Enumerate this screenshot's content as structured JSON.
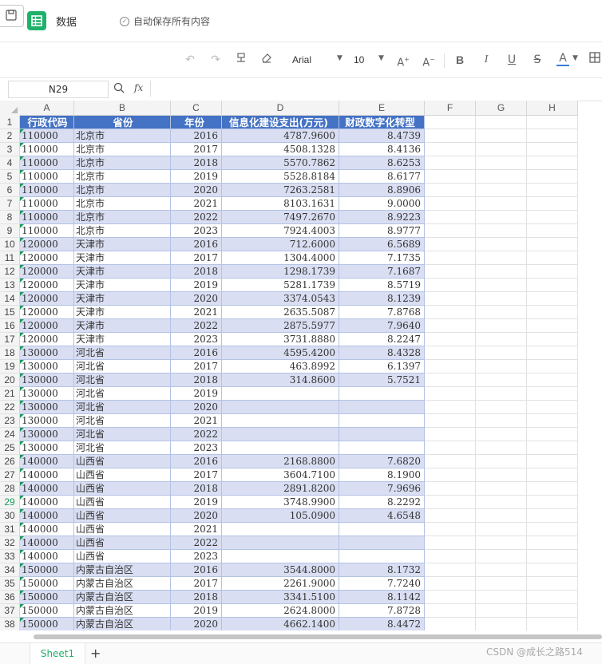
{
  "app": {
    "title": "数据",
    "autosave": "自动保存所有内容"
  },
  "toolbar": {
    "font": "Arial",
    "font_size": "10",
    "text_color": "#3a7bd5"
  },
  "formula_bar": {
    "cell_ref": "N29",
    "fx_label": "fx",
    "formula": ""
  },
  "columns": [
    "A",
    "B",
    "C",
    "D",
    "E",
    "F",
    "G",
    "H"
  ],
  "header_row": [
    "行政代码",
    "省份",
    "年份",
    "信息化建设支出(万元)",
    "财政数字化转型"
  ],
  "rows": [
    [
      "110000",
      "北京市",
      "2016",
      "4787.9600",
      "8.4739"
    ],
    [
      "110000",
      "北京市",
      "2017",
      "4508.1328",
      "8.4136"
    ],
    [
      "110000",
      "北京市",
      "2018",
      "5570.7862",
      "8.6253"
    ],
    [
      "110000",
      "北京市",
      "2019",
      "5528.8184",
      "8.6177"
    ],
    [
      "110000",
      "北京市",
      "2020",
      "7263.2581",
      "8.8906"
    ],
    [
      "110000",
      "北京市",
      "2021",
      "8103.1631",
      "9.0000"
    ],
    [
      "110000",
      "北京市",
      "2022",
      "7497.2670",
      "8.9223"
    ],
    [
      "110000",
      "北京市",
      "2023",
      "7924.4003",
      "8.9777"
    ],
    [
      "120000",
      "天津市",
      "2016",
      "712.6000",
      "6.5689"
    ],
    [
      "120000",
      "天津市",
      "2017",
      "1304.4000",
      "7.1735"
    ],
    [
      "120000",
      "天津市",
      "2018",
      "1298.1739",
      "7.1687"
    ],
    [
      "120000",
      "天津市",
      "2019",
      "5281.1739",
      "8.5719"
    ],
    [
      "120000",
      "天津市",
      "2020",
      "3374.0543",
      "8.1239"
    ],
    [
      "120000",
      "天津市",
      "2021",
      "2635.5087",
      "7.8768"
    ],
    [
      "120000",
      "天津市",
      "2022",
      "2875.5977",
      "7.9640"
    ],
    [
      "120000",
      "天津市",
      "2023",
      "3731.8880",
      "8.2247"
    ],
    [
      "130000",
      "河北省",
      "2016",
      "4595.4200",
      "8.4328"
    ],
    [
      "130000",
      "河北省",
      "2017",
      "463.8992",
      "6.1397"
    ],
    [
      "130000",
      "河北省",
      "2018",
      "314.8600",
      "5.7521"
    ],
    [
      "130000",
      "河北省",
      "2019",
      "",
      ""
    ],
    [
      "130000",
      "河北省",
      "2020",
      "",
      ""
    ],
    [
      "130000",
      "河北省",
      "2021",
      "",
      ""
    ],
    [
      "130000",
      "河北省",
      "2022",
      "",
      ""
    ],
    [
      "130000",
      "河北省",
      "2023",
      "",
      ""
    ],
    [
      "140000",
      "山西省",
      "2016",
      "2168.8800",
      "7.6820"
    ],
    [
      "140000",
      "山西省",
      "2017",
      "3604.7100",
      "8.1900"
    ],
    [
      "140000",
      "山西省",
      "2018",
      "2891.8200",
      "7.9696"
    ],
    [
      "140000",
      "山西省",
      "2019",
      "3748.9900",
      "8.2292"
    ],
    [
      "140000",
      "山西省",
      "2020",
      "105.0900",
      "4.6548"
    ],
    [
      "140000",
      "山西省",
      "2021",
      "",
      ""
    ],
    [
      "140000",
      "山西省",
      "2022",
      "",
      ""
    ],
    [
      "140000",
      "山西省",
      "2023",
      "",
      ""
    ],
    [
      "150000",
      "内蒙古自治区",
      "2016",
      "3544.8000",
      "8.1732"
    ],
    [
      "150000",
      "内蒙古自治区",
      "2017",
      "2261.9000",
      "7.7240"
    ],
    [
      "150000",
      "内蒙古自治区",
      "2018",
      "3341.5100",
      "8.1142"
    ],
    [
      "150000",
      "内蒙古自治区",
      "2019",
      "2624.8000",
      "7.8728"
    ],
    [
      "150000",
      "内蒙古自治区",
      "2020",
      "4662.1400",
      "8.4472"
    ]
  ],
  "selected_row": 29,
  "sheets": [
    {
      "name": "Sheet1",
      "active": true
    }
  ],
  "add_sheet_label": "+",
  "watermark": "CSDN @成长之路514",
  "colors": {
    "header_blue": "#4472c4",
    "band": "#d9def2",
    "brand_green": "#1fb16a"
  }
}
